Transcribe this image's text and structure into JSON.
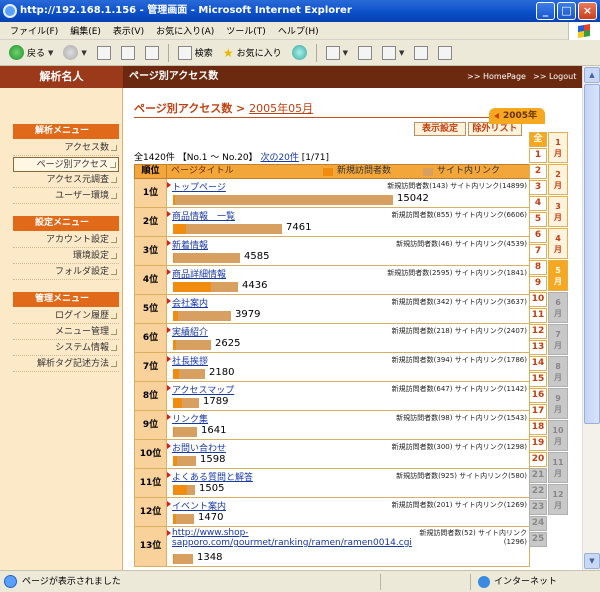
{
  "window": {
    "title": "http://192.168.1.156 - 管理画面 - Microsoft Internet Explorer",
    "controls": [
      "_",
      "□",
      "×"
    ]
  },
  "menubar": [
    "ファイル(F)",
    "編集(E)",
    "表示(V)",
    "お気に入り(A)",
    "ツール(T)",
    "ヘルプ(H)"
  ],
  "toolbar": {
    "back": "戻る",
    "search": "検索",
    "favorites": "お気に入り"
  },
  "status": {
    "text": "ページが表示されました",
    "zone": "インターネット"
  },
  "header": {
    "app_name": "解析名人",
    "page_title": "ページ別アクセス数",
    "link_home": ">> HomePage",
    "link_logout": ">> Logout"
  },
  "sidebar": {
    "sections": [
      {
        "title": "解析メニュー",
        "items": [
          "アクセス数",
          "ページ別アクセス",
          "アクセス元調査",
          "ユーザー環境"
        ]
      },
      {
        "title": "設定メニュー",
        "items": [
          "アカウント設定",
          "環境設定",
          "フォルダ設定"
        ]
      },
      {
        "title": "管理メニュー",
        "items": [
          "ログイン履歴",
          "メニュー管理",
          "システム情報",
          "解析タグ記述方法"
        ]
      }
    ],
    "active_item": "ページ別アクセス"
  },
  "main": {
    "heading": "ページ別アクセス数 >",
    "heading_date": "2005年05月",
    "btn_setting": "表示設定",
    "btn_exclude": "除外リスト",
    "summary_prefix": "全1420件 【No.1 ～ No.20】",
    "next_link": "次の20件",
    "page_info": "[1/71]"
  },
  "table": {
    "head_rank": "順位",
    "head_title": "ページタイトル",
    "legend_new": "新規訪問者数",
    "legend_inner": "サイト内リンク",
    "legend_new_color": "#f08c10",
    "legend_inner_color": "#d8a060",
    "max_value": 15042,
    "rows": [
      {
        "rank": "1位",
        "title": "トップページ",
        "stats": "新規訪問者数(143) サイト内リンク(14899)",
        "total": 15042,
        "new": 143,
        "count": "15042"
      },
      {
        "rank": "2位",
        "title": "商品情報　一覧",
        "stats": "新規訪問者数(855) サイト内リンク(6606)",
        "total": 7461,
        "new": 855,
        "count": "7461"
      },
      {
        "rank": "3位",
        "title": "新着情報",
        "stats": "新規訪問者数(46) サイト内リンク(4539)",
        "total": 4585,
        "new": 46,
        "count": "4585"
      },
      {
        "rank": "4位",
        "title": "商品詳細情報",
        "stats": "新規訪問者数(2595) サイト内リンク(1841)",
        "total": 4436,
        "new": 2595,
        "count": "4436"
      },
      {
        "rank": "5位",
        "title": "会社案内",
        "stats": "新規訪問者数(342) サイト内リンク(3637)",
        "total": 3979,
        "new": 342,
        "count": "3979"
      },
      {
        "rank": "6位",
        "title": "実績紹介",
        "stats": "新規訪問者数(218) サイト内リンク(2407)",
        "total": 2625,
        "new": 218,
        "count": "2625"
      },
      {
        "rank": "7位",
        "title": "社長挨拶",
        "stats": "新規訪問者数(394) サイト内リンク(1786)",
        "total": 2180,
        "new": 394,
        "count": "2180"
      },
      {
        "rank": "8位",
        "title": "アクセスマップ",
        "stats": "新規訪問者数(647) サイト内リンク(1142)",
        "total": 1789,
        "new": 647,
        "count": "1789"
      },
      {
        "rank": "9位",
        "title": "リンク集",
        "stats": "新規訪問者数(98) サイト内リンク(1543)",
        "total": 1641,
        "new": 98,
        "count": "1641"
      },
      {
        "rank": "10位",
        "title": "お問い合わせ",
        "stats": "新規訪問者数(300) サイト内リンク(1298)",
        "total": 1598,
        "new": 300,
        "count": "1598"
      },
      {
        "rank": "11位",
        "title": "よくある質問と解答",
        "stats": "新規訪問者数(925) サイト内リンク(580)",
        "total": 1505,
        "new": 925,
        "count": "1505"
      },
      {
        "rank": "12位",
        "title": "イベント案内",
        "stats": "新規訪問者数(201) サイト内リンク(1269)",
        "total": 1470,
        "new": 201,
        "count": "1470"
      },
      {
        "rank": "13位",
        "title": "http://www.shop-sapporo.com/gourmet/ranking/ramen/ramen0014.cgi",
        "stats": "新規訪問者数(52) サイト内リンク(1296)",
        "total": 1348,
        "new": 52,
        "count": "1348"
      }
    ]
  },
  "calendar": {
    "year": "2005年",
    "all_label": "全",
    "days": [
      "1",
      "2",
      "3",
      "4",
      "5",
      "6",
      "7",
      "8",
      "9",
      "10",
      "11",
      "12",
      "13",
      "14",
      "15",
      "16",
      "17",
      "18",
      "19",
      "20",
      "21",
      "22",
      "23",
      "24",
      "25"
    ],
    "enabled_days_upto": 20,
    "months": [
      "1月",
      "2月",
      "3月",
      "4月",
      "5月",
      "6月",
      "7月",
      "8月",
      "9月",
      "10月",
      "11月",
      "12月"
    ],
    "current_month": 5
  }
}
